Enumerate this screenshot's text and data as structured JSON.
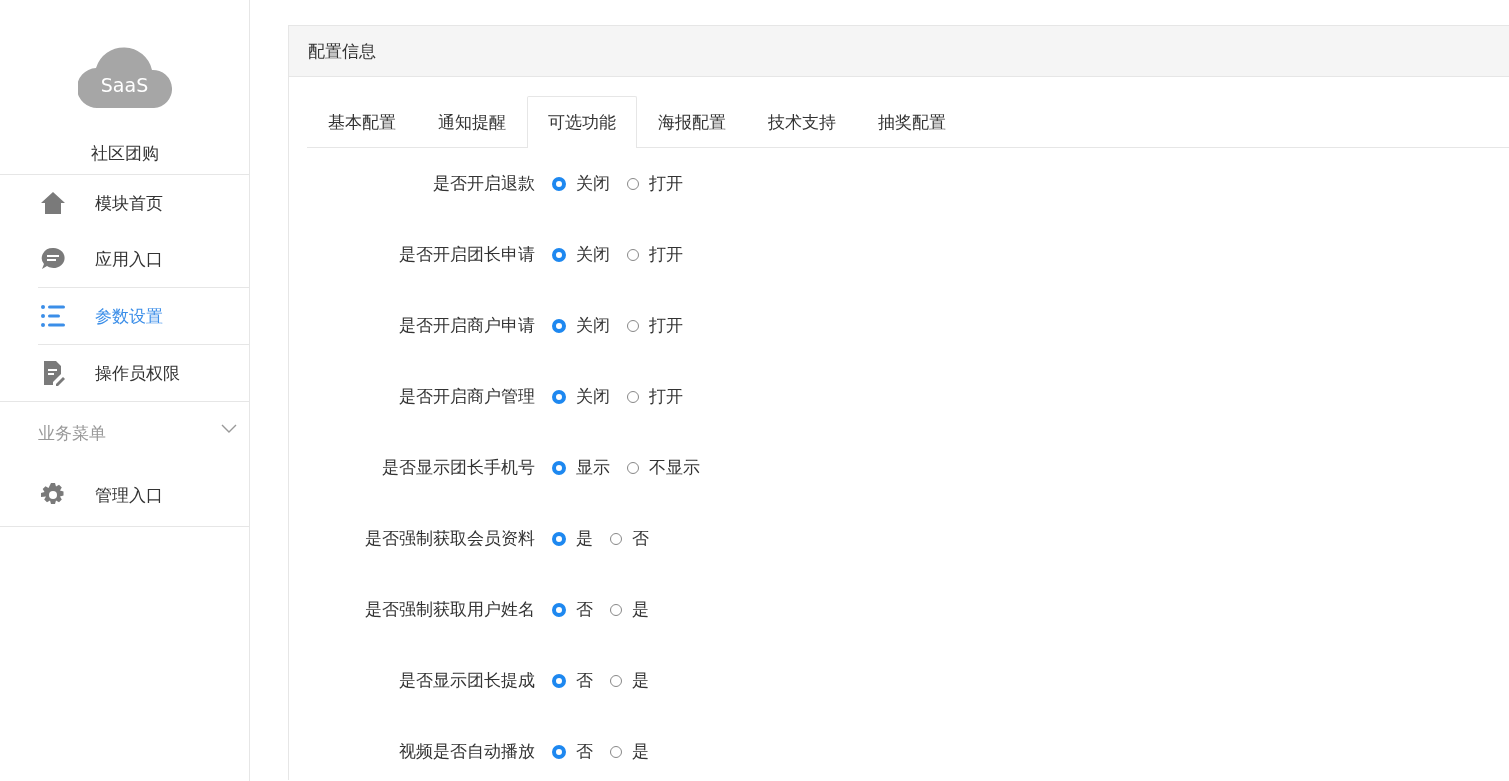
{
  "sidebar": {
    "logo": "SaaS",
    "app_name": "社区团购",
    "items": [
      {
        "label": "模块首页",
        "selected": false
      },
      {
        "label": "应用入口",
        "selected": false
      },
      {
        "label": "参数设置",
        "selected": true
      },
      {
        "label": "操作员权限",
        "selected": false
      }
    ],
    "group": {
      "label": "业务菜单",
      "expanded": true,
      "items": [
        {
          "label": "管理入口",
          "selected": false
        }
      ]
    }
  },
  "panel": {
    "title": "配置信息",
    "tabs": [
      {
        "label": "基本配置",
        "selected": false
      },
      {
        "label": "通知提醒",
        "selected": false
      },
      {
        "label": "可选功能",
        "selected": true
      },
      {
        "label": "海报配置",
        "selected": false
      },
      {
        "label": "技术支持",
        "selected": false
      },
      {
        "label": "抽奖配置",
        "selected": false
      }
    ],
    "rows": [
      {
        "label": "是否开启退款",
        "options": [
          {
            "label": "关闭",
            "selected": true
          },
          {
            "label": "打开",
            "selected": false
          }
        ]
      },
      {
        "label": "是否开启团长申请",
        "options": [
          {
            "label": "关闭",
            "selected": true
          },
          {
            "label": "打开",
            "selected": false
          }
        ]
      },
      {
        "label": "是否开启商户申请",
        "options": [
          {
            "label": "关闭",
            "selected": true
          },
          {
            "label": "打开",
            "selected": false
          }
        ]
      },
      {
        "label": "是否开启商户管理",
        "options": [
          {
            "label": "关闭",
            "selected": true
          },
          {
            "label": "打开",
            "selected": false
          }
        ]
      },
      {
        "label": "是否显示团长手机号",
        "options": [
          {
            "label": "显示",
            "selected": true
          },
          {
            "label": "不显示",
            "selected": false
          }
        ]
      },
      {
        "label": "是否强制获取会员资料",
        "options": [
          {
            "label": "是",
            "selected": true
          },
          {
            "label": "否",
            "selected": false
          }
        ]
      },
      {
        "label": "是否强制获取用户姓名",
        "options": [
          {
            "label": "否",
            "selected": true
          },
          {
            "label": "是",
            "selected": false
          }
        ]
      },
      {
        "label": "是否显示团长提成",
        "options": [
          {
            "label": "否",
            "selected": true
          },
          {
            "label": "是",
            "selected": false
          }
        ]
      },
      {
        "label": "视频是否自动播放",
        "options": [
          {
            "label": "否",
            "selected": true
          },
          {
            "label": "是",
            "selected": false
          }
        ]
      }
    ]
  }
}
